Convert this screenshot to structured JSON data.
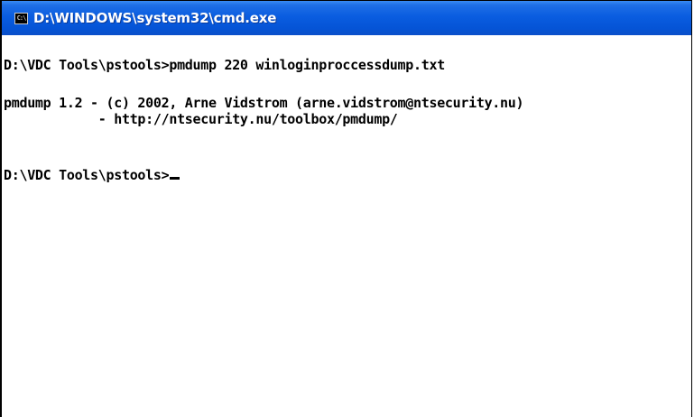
{
  "window": {
    "title": "D:\\WINDOWS\\system32\\cmd.exe",
    "icon": "cmd-icon",
    "icon_text": "C:\\"
  },
  "console": {
    "lines": [
      "D:\\VDC Tools\\pstools>pmdump 220 winloginproccessdump.txt",
      "pmdump 1.2 - (c) 2002, Arne Vidstrom (arne.vidstrom@ntsecurity.nu)",
      "            - http://ntsecurity.nu/toolbox/pmdump/",
      "D:\\VDC Tools\\pstools>"
    ]
  }
}
